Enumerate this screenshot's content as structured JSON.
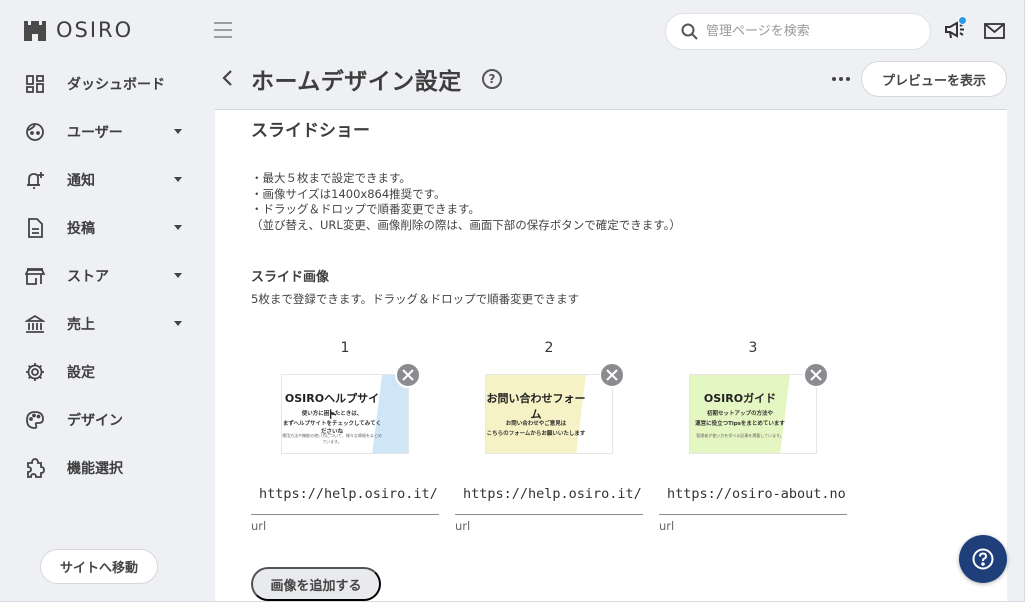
{
  "brand": {
    "name": "OSIRO"
  },
  "sidebar": {
    "items": [
      {
        "label": "ダッシュボード",
        "icon": "dashboard-icon",
        "has_arrow": false
      },
      {
        "label": "ユーザー",
        "icon": "user-face-icon",
        "has_arrow": true
      },
      {
        "label": "通知",
        "icon": "bell-plus-icon",
        "has_arrow": true
      },
      {
        "label": "投稿",
        "icon": "document-icon",
        "has_arrow": true
      },
      {
        "label": "ストア",
        "icon": "store-icon",
        "has_arrow": true
      },
      {
        "label": "売上",
        "icon": "bank-icon",
        "has_arrow": true
      },
      {
        "label": "設定",
        "icon": "gear-icon",
        "has_arrow": false
      },
      {
        "label": "デザイン",
        "icon": "palette-icon",
        "has_arrow": false
      },
      {
        "label": "機能選択",
        "icon": "puzzle-icon",
        "has_arrow": false
      }
    ],
    "site_button": "サイトへ移動"
  },
  "topbar": {
    "search_placeholder": "管理ページを検索",
    "notification_dot_color": "#2b9be5"
  },
  "header": {
    "title": "ホームデザイン設定",
    "help": "?",
    "preview_button": "プレビューを表示"
  },
  "section": {
    "title": "スライドショー",
    "notes": [
      "・最大５枚まで設定できます。",
      "・画像サイズは1400x864推奨です。",
      "・ドラッグ＆ドロップで順番変更できます。",
      "（並び替え、URL変更、画像削除の際は、画面下部の保存ボタンで確定できます。）"
    ],
    "images_heading": "スライド画像",
    "images_note": "5枚まで登録できます。ドラッグ＆ドロップで順番変更できます",
    "slides": [
      {
        "number": "1",
        "thumb_title": "OSIROヘルプサイト",
        "thumb_line1": "使い方に困ったときは、",
        "thumb_line2": "まずヘルプサイトをチェックしてみてくださいね",
        "thumb_small": "運用方法や機能の使い方について、様々な情報をまとめています。",
        "thumb_bg": "#ffffff",
        "thumb_accent": "#cfe6f7",
        "url": "https://help.osiro.it/hc/ja",
        "url_label": "url"
      },
      {
        "number": "2",
        "thumb_title": "お問い合わせフォーム",
        "thumb_line1": "お問い合わせやご意見は",
        "thumb_line2": "こちらのフォームからお願いいたします",
        "thumb_small": "",
        "thumb_bg": "#f6f2c6",
        "thumb_accent": "#ffffff",
        "url": "https://help.osiro.it/hc/ja",
        "url_label": "url"
      },
      {
        "number": "3",
        "thumb_title": "OSIROガイド",
        "thumb_line1": "初期セットアップの方法や",
        "thumb_line2": "運営に役立つTipsをまとめています",
        "thumb_small": "管理者が使い方を学べる記事を掲載しています。",
        "thumb_bg": "#e4f6c2",
        "thumb_accent": "#ffffff",
        "url": "https://osiro-about.notion.site",
        "url_label": "url"
      }
    ],
    "add_button": "画像を追加する"
  },
  "fab": {
    "label": "?",
    "color": "#1f3f7a"
  }
}
